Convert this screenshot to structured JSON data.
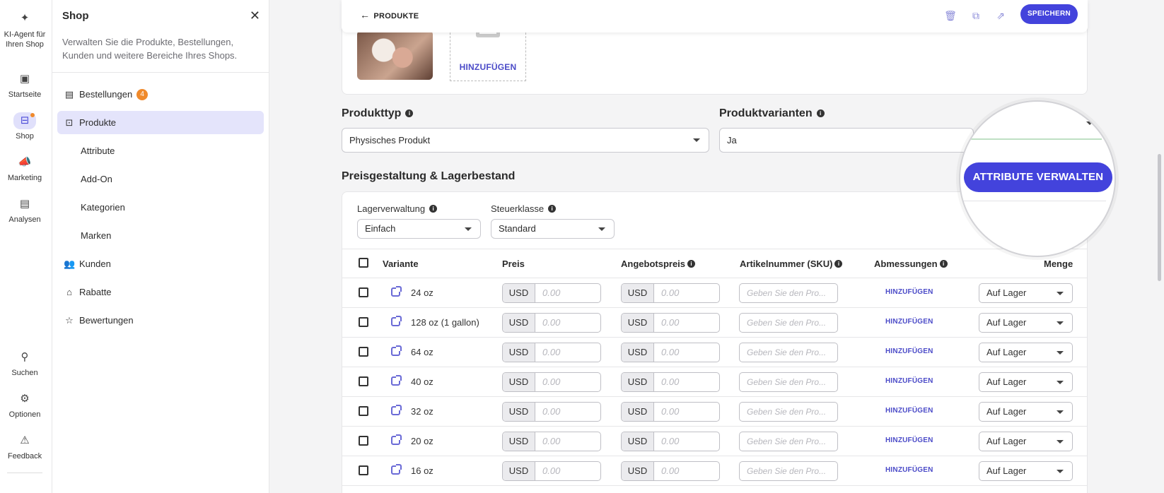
{
  "rail": {
    "items": [
      {
        "label": "KI-Agent für Ihren Shop",
        "icon": "sparkle-icon"
      },
      {
        "label": "Startseite",
        "icon": "dashboard-icon"
      },
      {
        "label": "Shop",
        "icon": "shop-icon"
      },
      {
        "label": "Marketing",
        "icon": "megaphone-icon"
      },
      {
        "label": "Analysen",
        "icon": "chart-icon"
      },
      {
        "label": "Suchen",
        "icon": "search-icon"
      },
      {
        "label": "Optionen",
        "icon": "gear-icon"
      },
      {
        "label": "Feedback",
        "icon": "feedback-icon"
      }
    ]
  },
  "panel": {
    "title": "Shop",
    "description": "Verwalten Sie die Produkte, Bestellungen, Kunden und weitere Bereiche Ihres Shops.",
    "nav": [
      {
        "label": "Bestellungen",
        "badge": "4"
      },
      {
        "label": "Produkte"
      },
      {
        "label": "Attribute"
      },
      {
        "label": "Add-On"
      },
      {
        "label": "Kategorien"
      },
      {
        "label": "Marken"
      },
      {
        "label": "Kunden"
      },
      {
        "label": "Rabatte"
      },
      {
        "label": "Bewertungen"
      }
    ]
  },
  "topbar": {
    "back_label": "PRODUKTE",
    "save_label": "SPEICHERN"
  },
  "media": {
    "add_label": "HINZUFÜGEN"
  },
  "product_type": {
    "label": "Produkttyp",
    "value": "Physisches Produkt"
  },
  "variants": {
    "label": "Produktvarianten",
    "value": "Ja"
  },
  "pricing": {
    "title": "Preisgestaltung & Lagerbestand",
    "manage_attributes_label": "ATTRIBUTE VERWALTEN",
    "inventory_label": "Lagerverwaltung",
    "inventory_value": "Einfach",
    "tax_label": "Steuerklasse",
    "tax_value": "Standard"
  },
  "table": {
    "headers": {
      "variant": "Variante",
      "price": "Preis",
      "sale_price": "Angebotspreis",
      "sku": "Artikelnummer (SKU)",
      "dimensions": "Abmessungen",
      "quantity": "Menge"
    },
    "rows": [
      {
        "variant": "24 oz",
        "currency": "USD",
        "price": "0.00",
        "sale_currency": "USD",
        "sale_price": "0.00",
        "sku_placeholder": "Geben Sie den Pro...",
        "dims": "HINZUFÜGEN",
        "qty": "Auf Lager"
      },
      {
        "variant": "128 oz (1 gallon)",
        "currency": "USD",
        "price": "0.00",
        "sale_currency": "USD",
        "sale_price": "0.00",
        "sku_placeholder": "Geben Sie den Pro...",
        "dims": "HINZUFÜGEN",
        "qty": "Auf Lager"
      },
      {
        "variant": "64 oz",
        "currency": "USD",
        "price": "0.00",
        "sale_currency": "USD",
        "sale_price": "0.00",
        "sku_placeholder": "Geben Sie den Pro...",
        "dims": "HINZUFÜGEN",
        "qty": "Auf Lager"
      },
      {
        "variant": "40 oz",
        "currency": "USD",
        "price": "0.00",
        "sale_currency": "USD",
        "sale_price": "0.00",
        "sku_placeholder": "Geben Sie den Pro...",
        "dims": "HINZUFÜGEN",
        "qty": "Auf Lager"
      },
      {
        "variant": "32 oz",
        "currency": "USD",
        "price": "0.00",
        "sale_currency": "USD",
        "sale_price": "0.00",
        "sku_placeholder": "Geben Sie den Pro...",
        "dims": "HINZUFÜGEN",
        "qty": "Auf Lager"
      },
      {
        "variant": "20 oz",
        "currency": "USD",
        "price": "0.00",
        "sale_currency": "USD",
        "sale_price": "0.00",
        "sku_placeholder": "Geben Sie den Pro...",
        "dims": "HINZUFÜGEN",
        "qty": "Auf Lager"
      },
      {
        "variant": "16 oz",
        "currency": "USD",
        "price": "0.00",
        "sale_currency": "USD",
        "sale_price": "0.00",
        "sku_placeholder": "Geben Sie den Pro...",
        "dims": "HINZUFÜGEN",
        "qty": "Auf Lager"
      }
    ]
  },
  "colors": {
    "accent": "#4343dc",
    "badge": "#f08a2b",
    "active_nav": "#e4e4fb"
  }
}
